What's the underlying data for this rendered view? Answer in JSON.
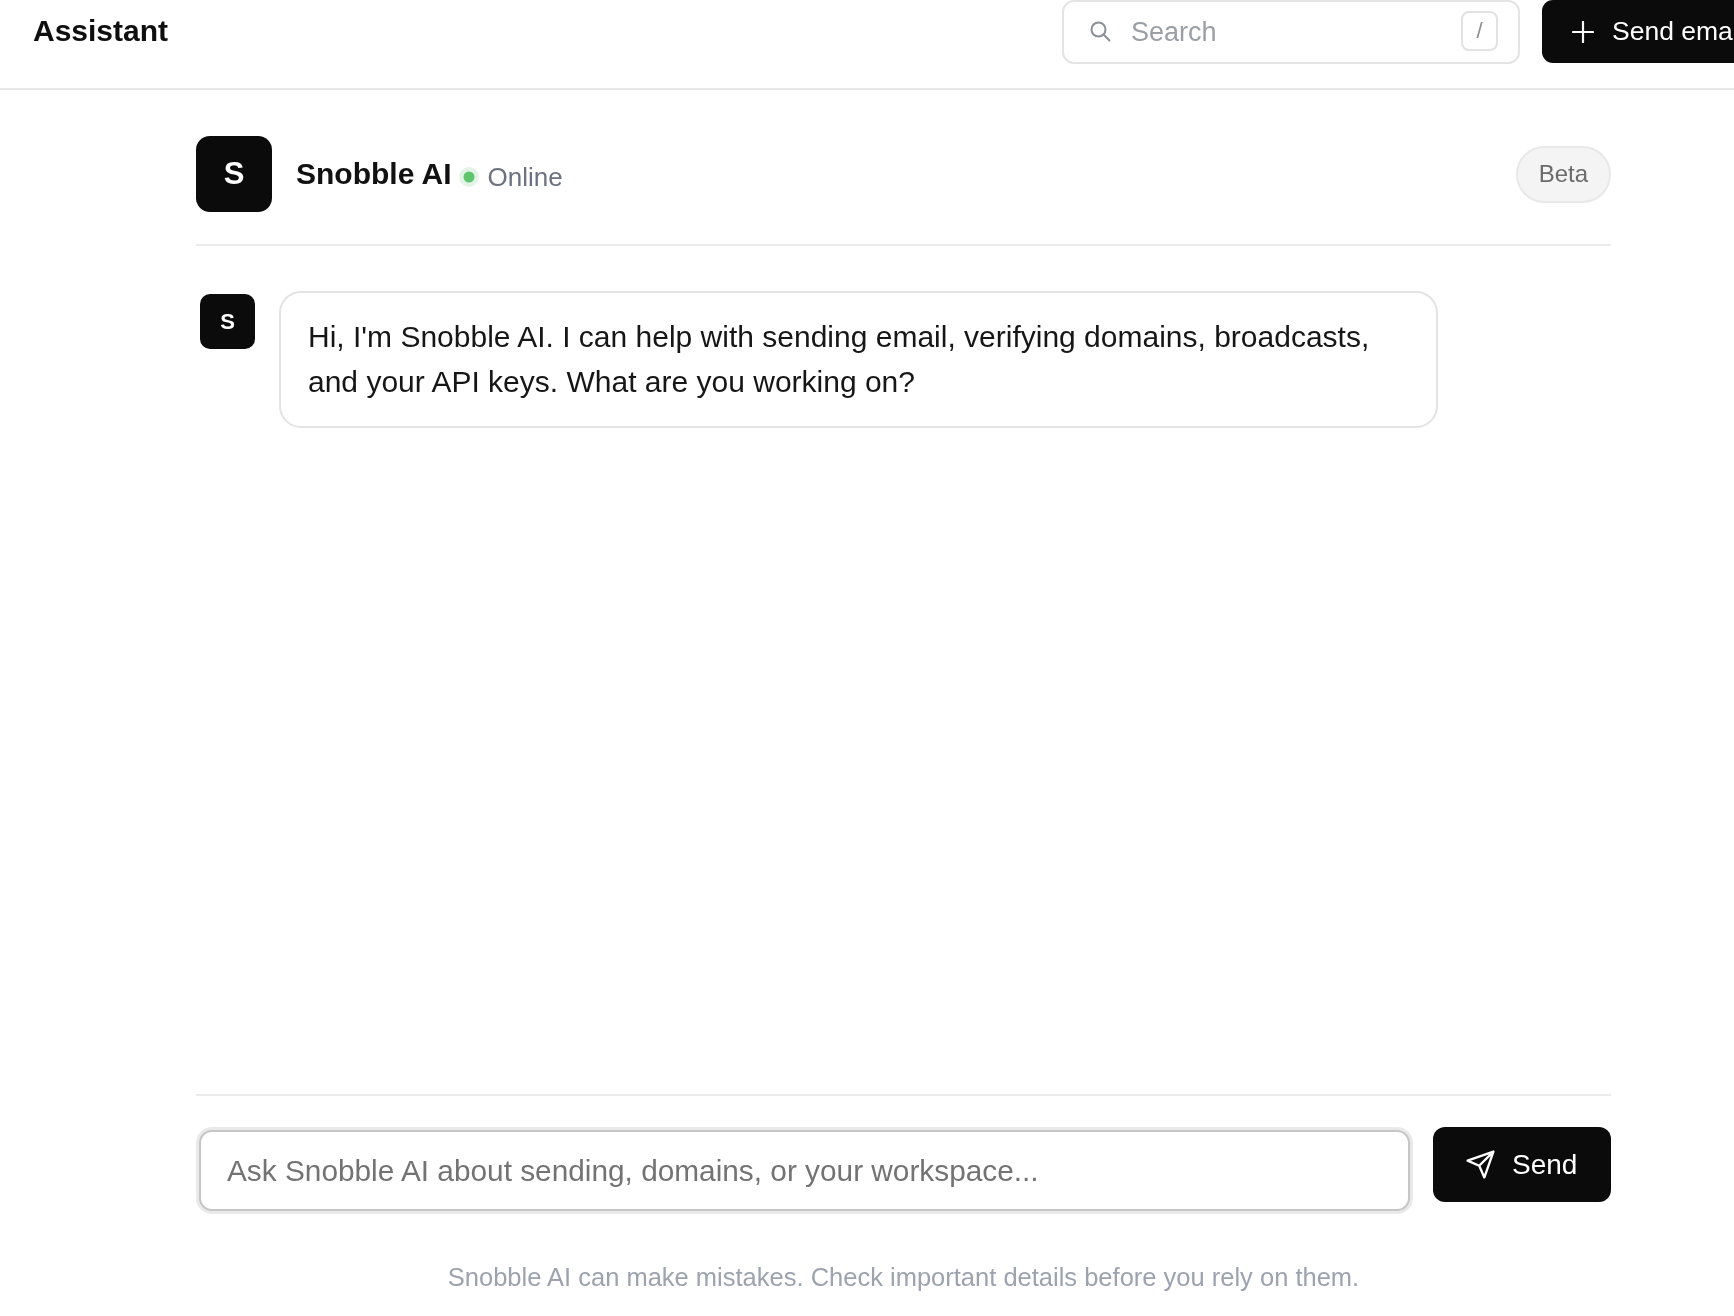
{
  "header": {
    "title": "Assistant",
    "search": {
      "placeholder": "Search",
      "shortcut": "/"
    },
    "primary_button": {
      "label": "Send ema"
    }
  },
  "assistant": {
    "avatar_letter": "S",
    "name": "Snobble AI",
    "status": {
      "label": "Online",
      "online": true
    },
    "badge": "Beta"
  },
  "messages": [
    {
      "kind": "assistant",
      "avatar_letter": "S",
      "text": "Hi, I'm Snobble AI. I can help with sending email, verifying domains, broadcasts, and your API keys. What are you working on?"
    }
  ],
  "composer": {
    "placeholder": "Ask Snobble AI about sending, domains, or your workspace...",
    "send_button": {
      "label": "Send"
    }
  },
  "disclaimer": "Snobble AI can make mistakes. Check important details before you rely on them."
}
